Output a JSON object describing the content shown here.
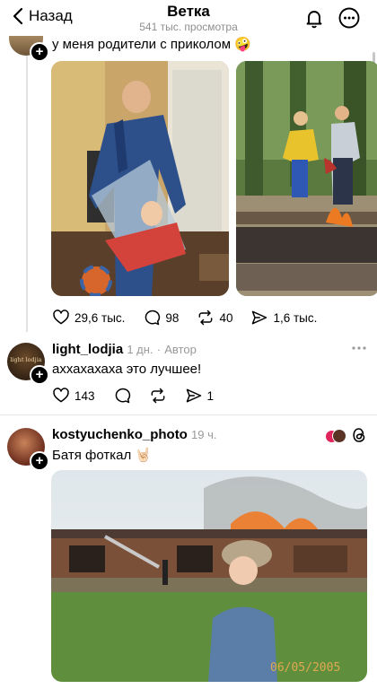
{
  "header": {
    "back_label": "Назад",
    "title": "Ветка",
    "subtitle": "541 тыс. просмотра"
  },
  "post1": {
    "text": "у меня родители с приколом",
    "emoji": "🤪",
    "stats": {
      "likes": "29,6 тыс.",
      "comments": "98",
      "reposts": "40",
      "shares": "1,6 тыс."
    }
  },
  "reply1": {
    "username": "light_lodjia",
    "time": "1 дн.",
    "separator": "·",
    "author_badge": "Автор",
    "text": "аххахахаха это лучшее!",
    "avatar_text": "light lodjia",
    "stats": {
      "likes": "143",
      "shares": "1"
    }
  },
  "post2": {
    "username": "kostyuchenko_photo",
    "time": "19 ч.",
    "text": "Батя фоткал",
    "emoji": "🤘🏻",
    "photo_date": "06/05/2005"
  },
  "colors": {
    "accent_text": "#000000",
    "meta_gray": "#999999",
    "divider": "#e6e6e6"
  }
}
